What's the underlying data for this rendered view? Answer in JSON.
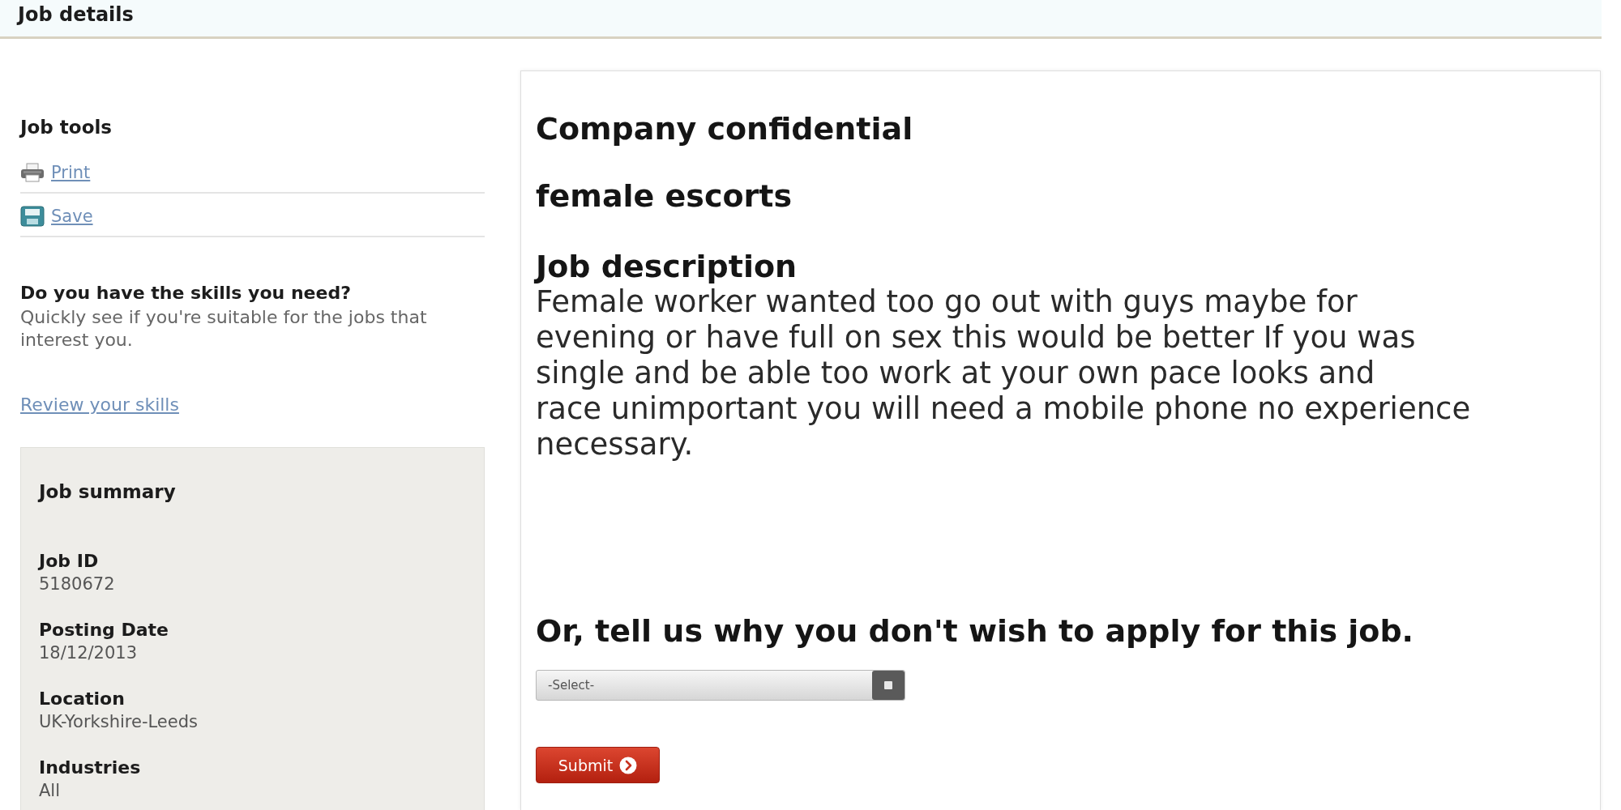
{
  "page_title": "Job details",
  "job_tools": {
    "heading": "Job tools",
    "links": [
      {
        "kind": "print",
        "label": "Print"
      },
      {
        "kind": "save",
        "label": "Save"
      }
    ]
  },
  "skills": {
    "heading": "Do you have the skills you need?",
    "text": "Quickly see if you're suitable for the jobs that interest you.",
    "link": "Review your skills"
  },
  "job_summary": {
    "heading": "Job summary",
    "fields": [
      {
        "label": "Job ID",
        "value": "5180672"
      },
      {
        "label": "Posting Date",
        "value": "18/12/2013"
      },
      {
        "label": "Location",
        "value": "UK-Yorkshire-Leeds"
      },
      {
        "label": "Industries",
        "value": "All"
      }
    ]
  },
  "job": {
    "company": "Company confidential",
    "title": "female escorts",
    "description_heading": "Job description",
    "description": "Female worker wanted too go out with guys maybe for\nevening or have full on sex this would be better If you was\nsingle and be able too work at your own pace looks and\nrace unimportant you will need a mobile phone no experience\nnecessary."
  },
  "decline": {
    "heading": "Or, tell us why you don't wish to apply for this job.",
    "select": {
      "value": "-Select-"
    },
    "submit": "Submit"
  }
}
